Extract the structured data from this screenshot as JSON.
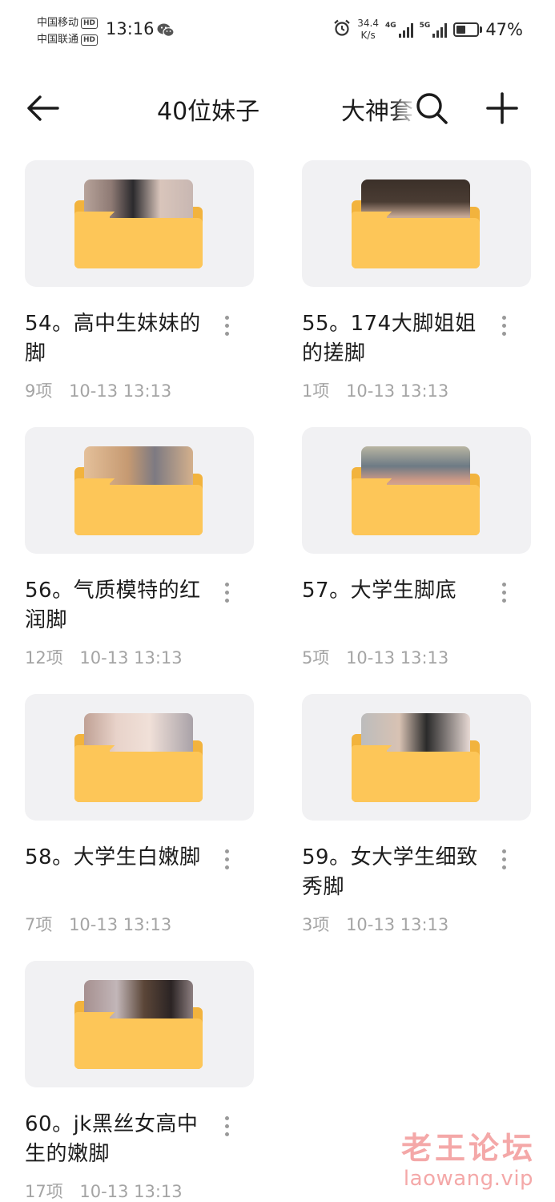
{
  "status_bar": {
    "carrier_1": "中国移动",
    "carrier_2": "中国联通",
    "hd_1": "HD",
    "hd_2": "HD",
    "time": "13:16",
    "net_speed_value": "34.4",
    "net_speed_unit": "K/s",
    "signal_1_tag": "4G",
    "signal_2_tag": "5G",
    "battery_level": 0.47,
    "battery_percent": "47%"
  },
  "header": {
    "title": "40位妹子",
    "subtitle": "大神套",
    "icons": [
      "back-arrow-icon",
      "search-icon",
      "add-icon"
    ]
  },
  "folders": [
    {
      "name": "54。高中生妹妹的脚",
      "count": "9项",
      "date": "10-13 13:13"
    },
    {
      "name": "55。174大脚姐姐的搓脚",
      "count": "1项",
      "date": "10-13 13:13"
    },
    {
      "name": "56。气质模特的红润脚",
      "count": "12项",
      "date": "10-13 13:13"
    },
    {
      "name": "57。大学生脚底",
      "count": "5项",
      "date": "10-13 13:13"
    },
    {
      "name": "58。大学生白嫩脚",
      "count": "7项",
      "date": "10-13 13:13"
    },
    {
      "name": "59。女大学生细致秀脚",
      "count": "3项",
      "date": "10-13 13:13"
    },
    {
      "name": "60。jk黑丝女高中生的嫩脚",
      "count": "17项",
      "date": "10-13 13:13"
    }
  ],
  "watermark": {
    "cn": "老王论坛",
    "en": "laowang.vip"
  },
  "colors": {
    "folder_back": "#f2b33d",
    "folder_front": "#fdc658",
    "card_bg": "#f1f1f3",
    "meta_text": "#a4a4a4",
    "watermark": "#f4a8a8"
  }
}
